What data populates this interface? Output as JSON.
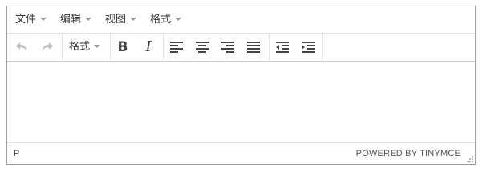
{
  "menubar": {
    "items": [
      {
        "label": "文件"
      },
      {
        "label": "编辑"
      },
      {
        "label": "视图"
      },
      {
        "label": "格式"
      }
    ]
  },
  "toolbar": {
    "format_label": "格式",
    "bold_label": "B",
    "italic_label": "I",
    "icons": [
      "undo-icon",
      "redo-icon",
      "bold-icon",
      "italic-icon",
      "align-left-icon",
      "align-center-icon",
      "align-right-icon",
      "align-justify-icon",
      "outdent-icon",
      "indent-icon"
    ]
  },
  "content": {
    "text": ""
  },
  "statusbar": {
    "path": "P",
    "powered": "POWERED BY TINYMCE"
  },
  "colors": {
    "border": "#9e9e9e",
    "icon": "#444444",
    "disabled_icon": "#bdbdbd",
    "separator": "#e2e2e2"
  }
}
